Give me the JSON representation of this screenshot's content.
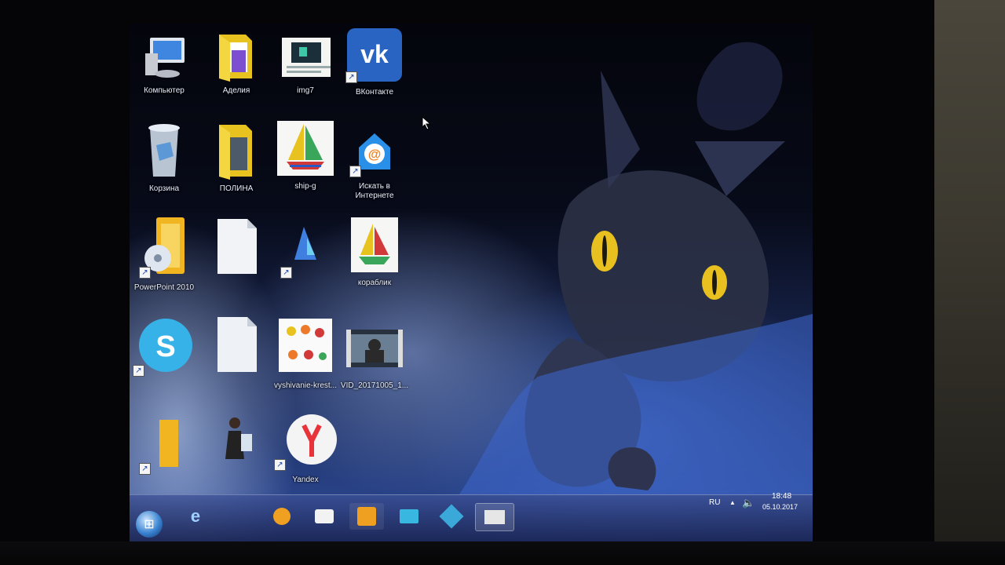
{
  "desktop": {
    "icons": [
      {
        "id": "computer",
        "label": "Компьютер",
        "icon": "computer-icon"
      },
      {
        "id": "adelia",
        "label": "Аделия",
        "icon": "folder-icon"
      },
      {
        "id": "img7",
        "label": "img7",
        "icon": "image-file-icon"
      },
      {
        "id": "vkontakte",
        "label": "ВКонтакте",
        "icon": "vk-icon"
      },
      {
        "id": "recycle",
        "label": "Корзина",
        "icon": "recycle-bin-icon"
      },
      {
        "id": "polina",
        "label": "ПОЛИНА",
        "icon": "folder-icon"
      },
      {
        "id": "ship-g",
        "label": "ship-g",
        "icon": "sailboat-image-icon"
      },
      {
        "id": "search-internet",
        "label": "Искать в Интернете",
        "icon": "mail-search-icon"
      },
      {
        "id": "powerpoint",
        "label": "PowerPoint 2010",
        "icon": "powerpoint-icon"
      },
      {
        "id": "file-blank",
        "label": "",
        "icon": "document-icon"
      },
      {
        "id": "paint-file",
        "label": "",
        "icon": "paint-image-icon"
      },
      {
        "id": "korablik",
        "label": "кораблик",
        "icon": "sailboat-image-icon"
      },
      {
        "id": "skype",
        "label": "",
        "icon": "skype-icon"
      },
      {
        "id": "file-copy",
        "label": "",
        "icon": "document-icon"
      },
      {
        "id": "vyshivanie",
        "label": "vyshivanie-krest...",
        "icon": "embroidery-image-icon"
      },
      {
        "id": "video",
        "label": "VID_20171005_1...",
        "icon": "video-file-icon"
      },
      {
        "id": "word",
        "label": "",
        "icon": "office-icon"
      },
      {
        "id": "girl-picture",
        "label": "",
        "icon": "girl-picture-icon"
      },
      {
        "id": "yandex",
        "label": "Yandex",
        "icon": "yandex-browser-icon"
      }
    ]
  },
  "taskbar": {
    "start_icon": "windows-start-icon",
    "pinned": [
      {
        "id": "ie",
        "icon": "internet-explorer-icon"
      },
      {
        "id": "media",
        "icon": "media-player-icon"
      },
      {
        "id": "explorer",
        "icon": "file-explorer-icon"
      },
      {
        "id": "store",
        "icon": "store-bag-icon"
      },
      {
        "id": "mail",
        "icon": "mail-client-icon"
      },
      {
        "id": "app",
        "icon": "app-icon"
      },
      {
        "id": "window",
        "icon": "window-icon"
      }
    ],
    "tray": {
      "language": "RU",
      "arrow": "▲",
      "volume_icon": "volume-icon",
      "time": "18:48",
      "date": "05.10.2017"
    }
  },
  "colors": {
    "vk_blue": "#2a64c3",
    "folder_yellow": "#e8c21e",
    "skype_blue": "#37b2e8",
    "yandex_red": "#e8333a",
    "cat_eye": "#e8c020"
  }
}
